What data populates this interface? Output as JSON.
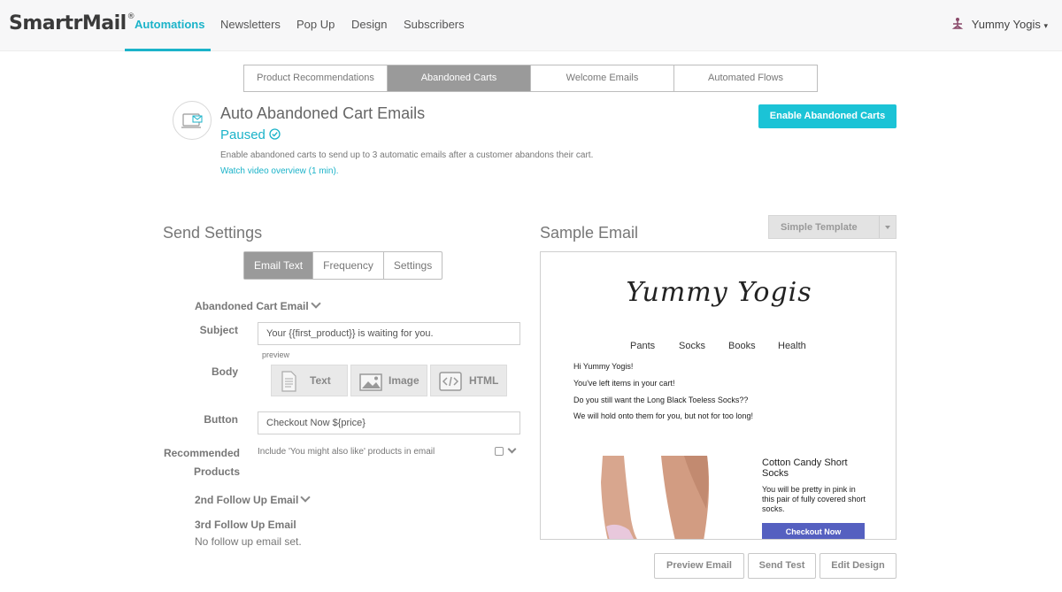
{
  "app": {
    "logo": "SmartrMail",
    "logo_mark": "®",
    "nav": [
      "Automations",
      "Newsletters",
      "Pop Up",
      "Design",
      "Subscribers"
    ],
    "user": "Yummy Yogis",
    "accent_color": "#1bb3c9"
  },
  "automation_tabs": [
    "Product Recommendations",
    "Abandoned Carts",
    "Welcome Emails",
    "Automated Flows"
  ],
  "header": {
    "title": "Auto Abandoned Cart Emails",
    "status": "Paused",
    "description": "Enable abandoned carts to send up to 3 automatic emails after a customer abandons their cart.",
    "video_link": "Watch video overview (1 min).",
    "enable_button": "Enable Abandoned Carts"
  },
  "send_settings": {
    "title": "Send Settings",
    "tabs": [
      "Email Text",
      "Frequency",
      "Settings"
    ],
    "email_section": "Abandoned Cart Email",
    "subject_label": "Subject",
    "subject_value": "Your {{first_product}} is waiting for you.",
    "preview_label": "preview",
    "body_label": "Body",
    "body_options": [
      "Text",
      "Image",
      "HTML"
    ],
    "button_label": "Button",
    "button_value": "Checkout Now ${price}",
    "recommended_label_1": "Recommended",
    "recommended_label_2": "Products",
    "recommended_text": "Include 'You might also like' products in email",
    "followup_2": "2nd Follow Up Email",
    "followup_3": "3rd Follow Up Email",
    "followup_3_note": "No follow up email set."
  },
  "sample_email": {
    "title": "Sample Email",
    "template_select": "Simple Template",
    "brand": "Yummy Yogis",
    "nav": [
      "Pants",
      "Socks",
      "Books",
      "Health"
    ],
    "lines": [
      "Hi Yummy Yogis!",
      "You've left items in your cart!",
      "Do you still want the Long Black Toeless Socks??",
      "We will hold onto them for you, but not for too long!"
    ],
    "product_name": "Cotton Candy Short Socks",
    "product_desc": "You will be pretty in pink in this pair of fully covered short socks.",
    "checkout_button": "Checkout Now"
  },
  "actions": [
    "Preview Email",
    "Send Test",
    "Edit Design"
  ]
}
